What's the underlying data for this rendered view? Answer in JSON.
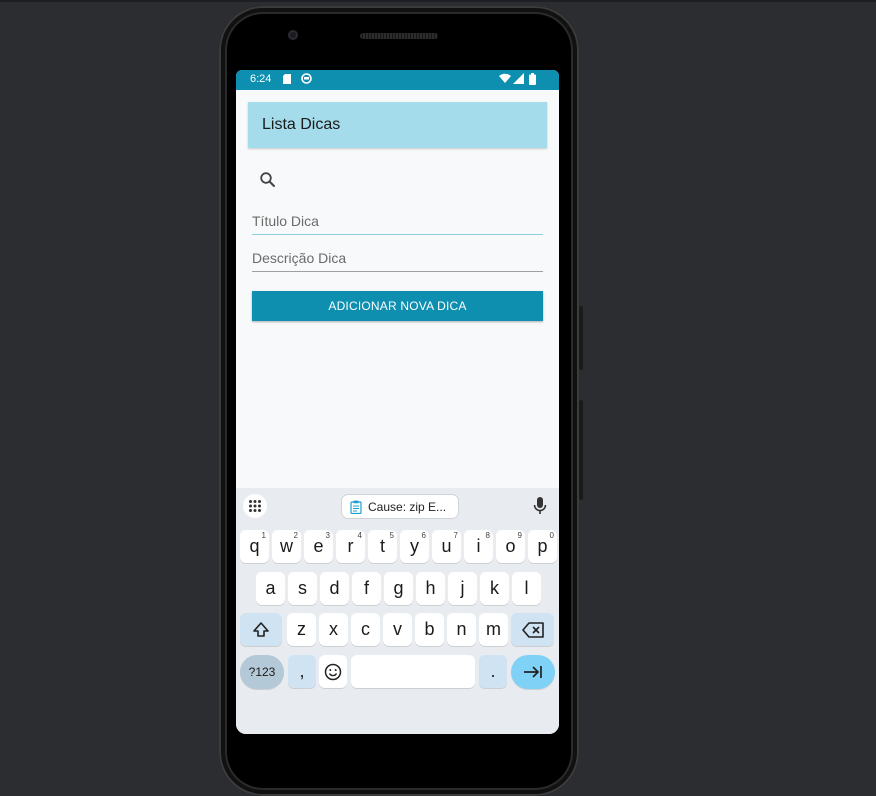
{
  "status_bar": {
    "time": "6:24"
  },
  "app_bar": {
    "title": "Lista Dicas"
  },
  "form": {
    "title_placeholder": "Título Dica",
    "description_placeholder": "Descrição Dica",
    "add_button_label": "ADICIONAR NOVA DICA"
  },
  "keyboard": {
    "suggestion_chip": "Cause: zip E...",
    "row1": [
      {
        "k": "q",
        "h": "1"
      },
      {
        "k": "w",
        "h": "2"
      },
      {
        "k": "e",
        "h": "3"
      },
      {
        "k": "r",
        "h": "4"
      },
      {
        "k": "t",
        "h": "5"
      },
      {
        "k": "y",
        "h": "6"
      },
      {
        "k": "u",
        "h": "7"
      },
      {
        "k": "i",
        "h": "8"
      },
      {
        "k": "o",
        "h": "9"
      },
      {
        "k": "p",
        "h": "0"
      }
    ],
    "row2": [
      "a",
      "s",
      "d",
      "f",
      "g",
      "h",
      "j",
      "k",
      "l"
    ],
    "row3": [
      "z",
      "x",
      "c",
      "v",
      "b",
      "n",
      "m"
    ],
    "symbols_label": "?123",
    "comma": ",",
    "period": "."
  },
  "colors": {
    "status_bar": "#0e8fb0",
    "app_bar": "#a4dceb",
    "button": "#0e8fb0",
    "keyboard_bg": "#e8ecf0",
    "enter_key": "#7fd2f5"
  }
}
